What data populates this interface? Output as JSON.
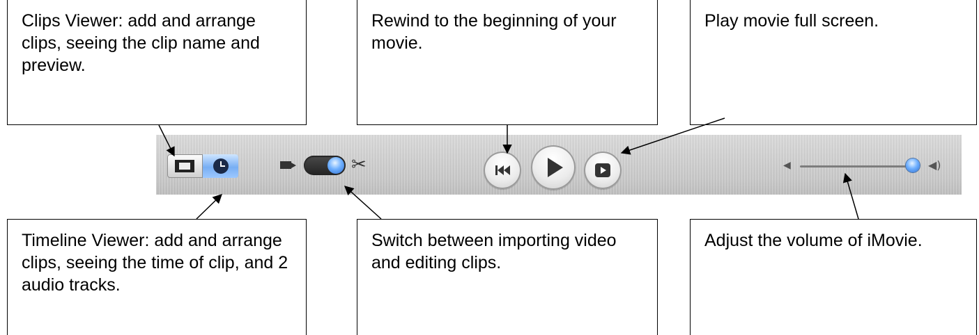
{
  "callouts": {
    "clips_viewer": "Clips Viewer: add and arrange clips, seeing the clip name and preview.",
    "rewind": "Rewind to the beginning of your movie.",
    "full_screen": "Play movie full screen.",
    "timeline_viewer": "Timeline Viewer: add and arrange clips, seeing the time of clip, and 2 audio tracks.",
    "mode_switch": "Switch between importing video and editing clips.",
    "volume": "Adjust the volume of iMovie."
  },
  "toolbar": {
    "icons": {
      "clips_view": "film-strip-icon",
      "timeline_view": "clock-icon",
      "camera_mode": "camera-icon",
      "edit_mode": "scissors-icon",
      "rewind": "rewind-icon",
      "play": "play-icon",
      "full_screen": "full-screen-play-icon",
      "volume_low": "speaker-low-icon",
      "volume_high": "speaker-high-icon"
    },
    "selected_view": "timeline",
    "mode": "edit",
    "volume_level": 0.95,
    "accent_color": "#4f94ee"
  }
}
